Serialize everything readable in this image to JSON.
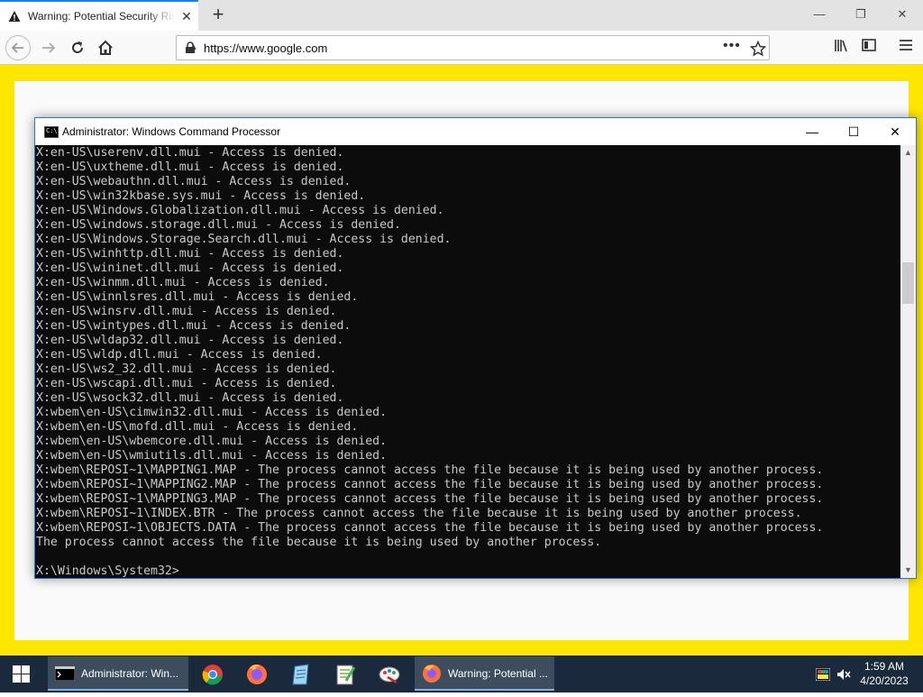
{
  "browser": {
    "tab_title": "Warning: Potential Security Risk Ahead",
    "url": "https://www.google.com",
    "url_more": "•••",
    "new_tab": "+",
    "close_tab": "✕",
    "win_min": "—",
    "win_max": "❐",
    "win_close": "✕"
  },
  "cmd": {
    "title": "Administrator: Windows Command Processor",
    "min": "—",
    "max": "☐",
    "close": "✕",
    "lines": [
      "X:en-US\\userenv.dll.mui - Access is denied.",
      "X:en-US\\uxtheme.dll.mui - Access is denied.",
      "X:en-US\\webauthn.dll.mui - Access is denied.",
      "X:en-US\\win32kbase.sys.mui - Access is denied.",
      "X:en-US\\Windows.Globalization.dll.mui - Access is denied.",
      "X:en-US\\windows.storage.dll.mui - Access is denied.",
      "X:en-US\\Windows.Storage.Search.dll.mui - Access is denied.",
      "X:en-US\\winhttp.dll.mui - Access is denied.",
      "X:en-US\\wininet.dll.mui - Access is denied.",
      "X:en-US\\winmm.dll.mui - Access is denied.",
      "X:en-US\\winnlsres.dll.mui - Access is denied.",
      "X:en-US\\winsrv.dll.mui - Access is denied.",
      "X:en-US\\wintypes.dll.mui - Access is denied.",
      "X:en-US\\wldap32.dll.mui - Access is denied.",
      "X:en-US\\wldp.dll.mui - Access is denied.",
      "X:en-US\\ws2_32.dll.mui - Access is denied.",
      "X:en-US\\wscapi.dll.mui - Access is denied.",
      "X:en-US\\wsock32.dll.mui - Access is denied.",
      "X:wbem\\en-US\\cimwin32.dll.mui - Access is denied.",
      "X:wbem\\en-US\\mofd.dll.mui - Access is denied.",
      "X:wbem\\en-US\\wbemcore.dll.mui - Access is denied.",
      "X:wbem\\en-US\\wmiutils.dll.mui - Access is denied.",
      "X:wbem\\REPOSI~1\\MAPPING1.MAP - The process cannot access the file because it is being used by another process.",
      "X:wbem\\REPOSI~1\\MAPPING2.MAP - The process cannot access the file because it is being used by another process.",
      "X:wbem\\REPOSI~1\\MAPPING3.MAP - The process cannot access the file because it is being used by another process.",
      "X:wbem\\REPOSI~1\\INDEX.BTR - The process cannot access the file because it is being used by another process.",
      "X:wbem\\REPOSI~1\\OBJECTS.DATA - The process cannot access the file because it is being used by another process.",
      "The process cannot access the file because it is being used by another process.",
      "",
      "X:\\Windows\\System32>"
    ]
  },
  "taskbar": {
    "cmd_label": "Administrator: Win...",
    "firefox_label": "Warning: Potential ...",
    "time": "1:59 AM",
    "date": "4/20/2023",
    "icons": [
      "windows-start-icon",
      "chrome-icon",
      "firefox-icon",
      "notepad-icon",
      "notepadpp-icon",
      "paint-icon"
    ]
  },
  "colors": {
    "page_background": "#ffe600",
    "cmd_background": "#0c0c0c",
    "cmd_text": "#c8c8c8",
    "tab_accent": "#0a84ff",
    "taskbar": "#1a2a3c"
  }
}
